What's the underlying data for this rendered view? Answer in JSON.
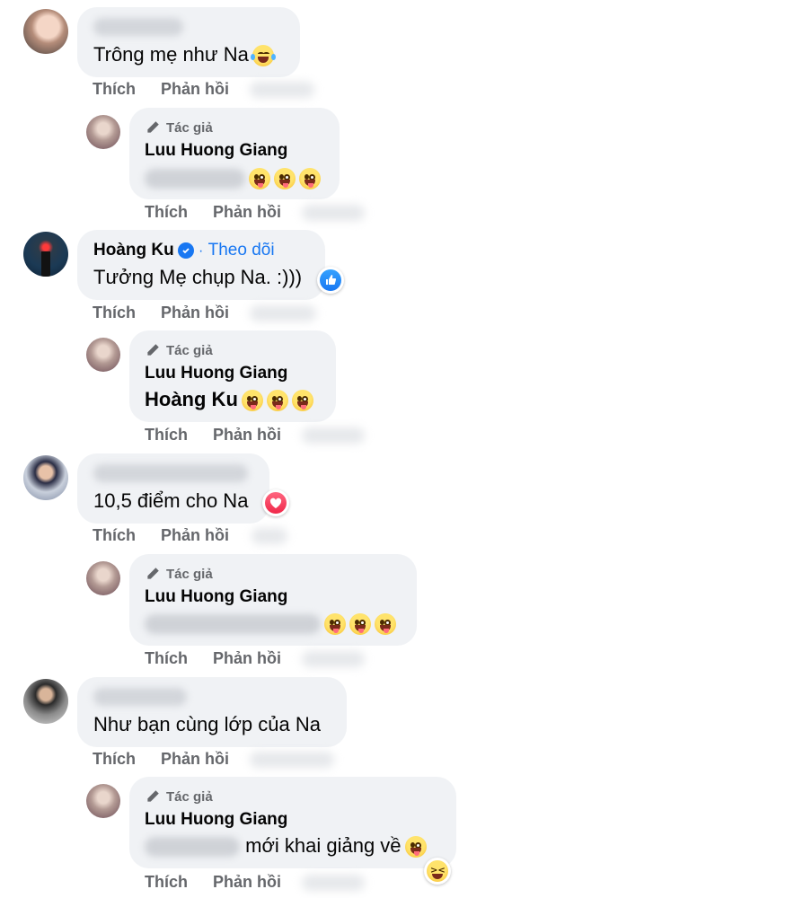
{
  "actions": {
    "like": "Thích",
    "reply": "Phản hồi"
  },
  "author_badge": "Tác giả",
  "threads": [
    {
      "comment": {
        "text": "Trông mẹ như Na"
      },
      "reply": {
        "author": "Luu Huong Giang",
        "text": ""
      }
    },
    {
      "comment": {
        "name": "Hoàng Ku",
        "separator": "·",
        "follow_label": "Theo dõi",
        "text": "Tưởng Mẹ chụp Na. :)))"
      },
      "reply": {
        "author": "Luu Huong Giang",
        "mention": "Hoàng Ku"
      }
    },
    {
      "comment": {
        "text": "10,5 điểm cho Na"
      },
      "reply": {
        "author": "Luu Huong Giang"
      }
    },
    {
      "comment": {
        "text": "Như bạn cùng lớp của Na"
      },
      "reply": {
        "author": "Luu Huong Giang",
        "text": "mới khai giảng về"
      }
    }
  ],
  "colors": {
    "bubble": "#f0f2f5",
    "meta": "#65676b",
    "link": "#1877f2",
    "love": "#f02849"
  },
  "icons": {
    "author": "pencil-icon",
    "verified": "verified-badge-icon",
    "reactions": [
      "like-reaction-icon",
      "love-reaction-icon",
      "haha-reaction-icon"
    ],
    "emoji": [
      "tears-of-joy-emoji",
      "winking-tongue-emoji"
    ]
  }
}
